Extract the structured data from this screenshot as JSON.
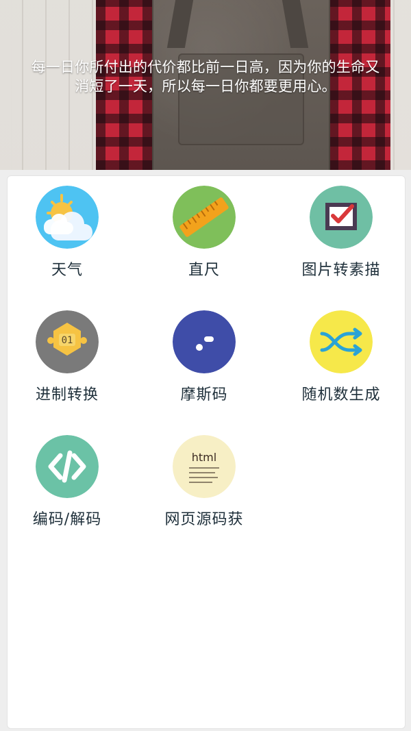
{
  "header": {
    "quote_line1": "每一日你所付出的代价都比前一日高，因为你的生命又",
    "quote_line2": "消短了一天，所以每一日你都要更用心。"
  },
  "apps": [
    {
      "label": "天气",
      "icon": "weather-icon",
      "bg": "#4ec3f2"
    },
    {
      "label": "直尺",
      "icon": "ruler-icon",
      "bg": "#7fbf5a"
    },
    {
      "label": "图片转素描",
      "icon": "sketch-checkbox-icon",
      "bg": "#6fbfa4"
    },
    {
      "label": "进制转换",
      "icon": "base-conversion-icon",
      "bg": "#7a7a7a"
    },
    {
      "label": "摩斯码",
      "icon": "morse-code-icon",
      "bg": "#3f4da8"
    },
    {
      "label": "随机数生成",
      "icon": "shuffle-icon",
      "bg": "#f6e84a"
    },
    {
      "label": "编码/解码",
      "icon": "code-brackets-icon",
      "bg": "#6bc2a6"
    },
    {
      "label": "网页源码获",
      "icon": "html-source-icon",
      "bg": "#f7efc5"
    }
  ]
}
